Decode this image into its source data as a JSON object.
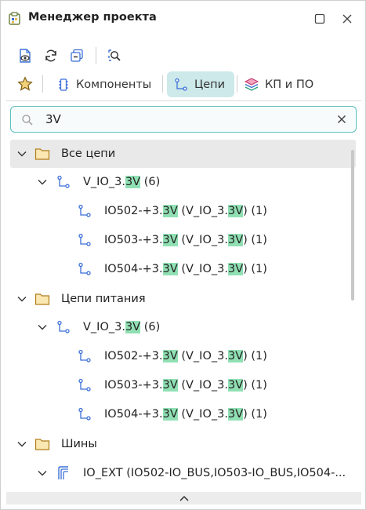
{
  "window": {
    "title": "Менеджер проекта"
  },
  "toolbar": {
    "buttons": [
      {
        "icon": "document-eye-icon"
      },
      {
        "icon": "refresh-icon"
      },
      {
        "icon": "collapse-all-icon"
      },
      {
        "icon": "search-document-icon"
      }
    ]
  },
  "tabs": [
    {
      "label": "Компоненты",
      "icon": "component-chip-icon",
      "active": false
    },
    {
      "label": "Цепи",
      "icon": "net-icon",
      "active": true
    },
    {
      "label": "КП и ПО",
      "icon": "layers-icon",
      "active": false
    }
  ],
  "search": {
    "value": "3V"
  },
  "tree": {
    "group1": {
      "label": "Все цепи",
      "net": {
        "prefix": "V_IO_3.",
        "match": "3V",
        "suffix": " (6)"
      },
      "items": [
        {
          "a": "IO502-+3.",
          "m1": "3V",
          "b": " (V_IO_3.",
          "m2": "3V",
          "c": ") (1)"
        },
        {
          "a": "IO503-+3.",
          "m1": "3V",
          "b": " (V_IO_3.",
          "m2": "3V",
          "c": ") (1)"
        },
        {
          "a": "IO504-+3.",
          "m1": "3V",
          "b": " (V_IO_3.",
          "m2": "3V",
          "c": ") (1)"
        }
      ]
    },
    "group2": {
      "label": "Цепи питания",
      "net": {
        "prefix": "V_IO_3.",
        "match": "3V",
        "suffix": " (6)"
      },
      "items": [
        {
          "a": "IO502-+3.",
          "m1": "3V",
          "b": " (V_IO_3.",
          "m2": "3V",
          "c": ") (1)"
        },
        {
          "a": "IO503-+3.",
          "m1": "3V",
          "b": " (V_IO_3.",
          "m2": "3V",
          "c": ") (1)"
        },
        {
          "a": "IO504-+3.",
          "m1": "3V",
          "b": " (V_IO_3.",
          "m2": "3V",
          "c": ") (1)"
        }
      ]
    },
    "group3": {
      "label": "Шины",
      "bus": {
        "label": "IO_EXT (IO502-IO_BUS,IO503-IO_BUS,IO504-..."
      }
    }
  },
  "colors": {
    "accent": "#5dbfbd",
    "active_tab": "#cde9ea",
    "highlight": "#90e0b4",
    "icon_blue": "#3b6fd6",
    "folder": "#e8b84a"
  }
}
